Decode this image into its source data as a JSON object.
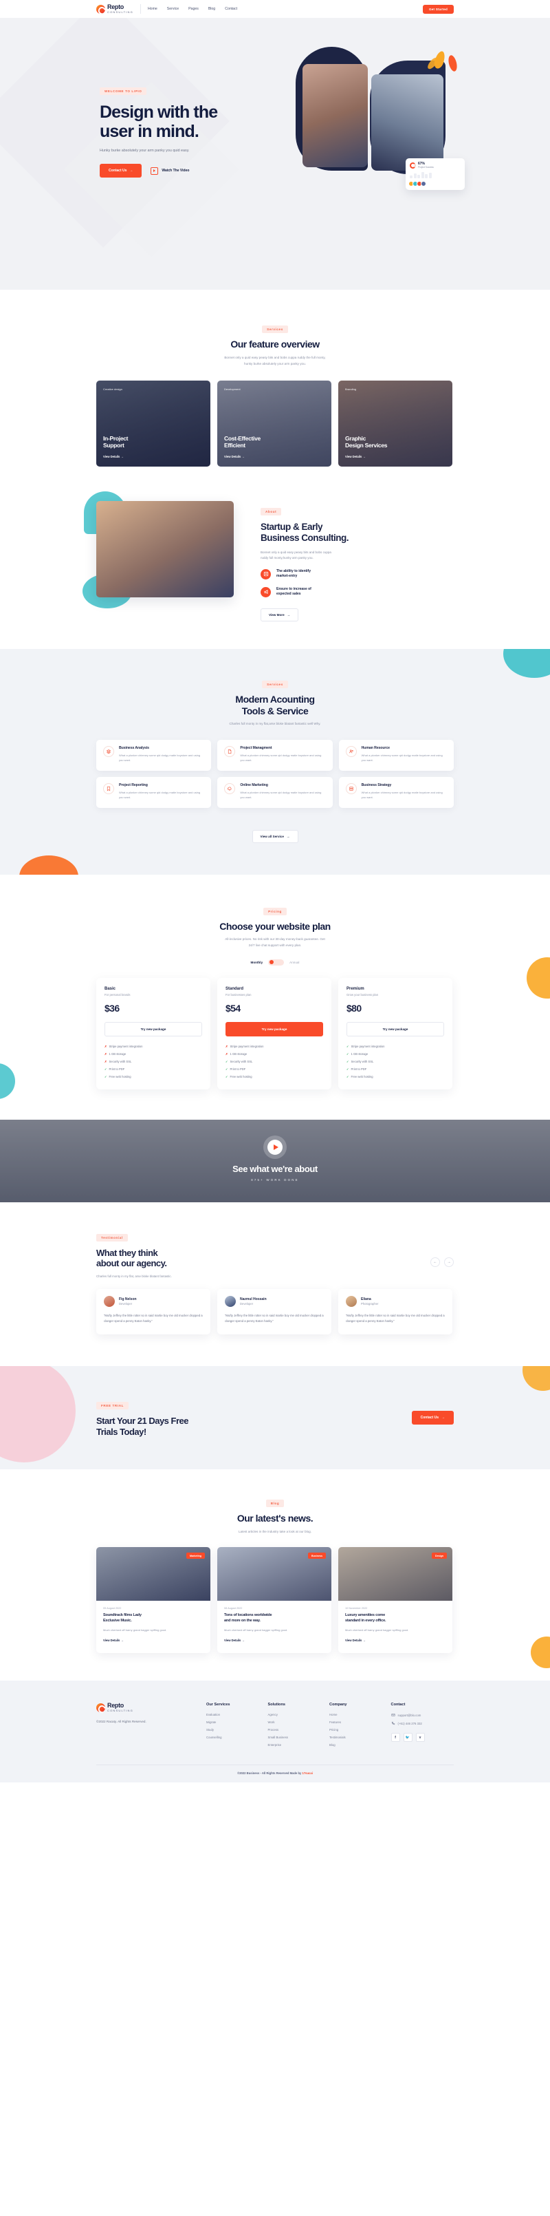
{
  "brand": {
    "name": "Repto",
    "sub": "CONSULTING",
    "accent": "#f94b2a",
    "dark": "#131c3f"
  },
  "header": {
    "nav": [
      {
        "label": "Home"
      },
      {
        "label": "Service"
      },
      {
        "label": "Pages"
      },
      {
        "label": "Blog"
      },
      {
        "label": "Contact"
      }
    ],
    "cta": "Get Started"
  },
  "hero": {
    "tag": "WELCOME TO LIPIO",
    "title_line1": "Design with the",
    "title_line2": "user in mind.",
    "subtitle": "Hunky burke absolutely your arm panky you quid easy.",
    "primary_btn": "Contact Us",
    "video_btn": "Watch The Video",
    "stat_percent": "67%",
    "stat_caption": "Project Success"
  },
  "features": {
    "tag": "Services",
    "title": "Our feature overview",
    "desc_line1": "Bonnet only a quid easy peasy bits and bobs cuppa ruddy the full monty,",
    "desc_line2": "hunky burke absolutely your arm panky you.",
    "cards": [
      {
        "category": "Creative design",
        "title_l1": "In-Project",
        "title_l2": "Support",
        "link": "View Details"
      },
      {
        "category": "Development",
        "title_l1": "Cost-Effective",
        "title_l2": "Efficient",
        "link": "View Details"
      },
      {
        "category": "Branding",
        "title_l1": "Graphic",
        "title_l2": "Design Services",
        "link": "View Details"
      }
    ]
  },
  "about": {
    "tag": "About",
    "title_l1": "Startup & Early",
    "title_l2": "Business Consulting.",
    "desc_l1": "Bonnet only a quid easy peasy bits and bobs cuppa",
    "desc_l2": "ruddy full monty,hunky arm panky you.",
    "points": [
      {
        "icon": "list-icon",
        "text_l1": "The ability to identify",
        "text_l2": "market-entry"
      },
      {
        "icon": "megaphone-icon",
        "text_l1": "Ensure to increase of",
        "text_l2": "expected sales"
      }
    ],
    "button": "View More"
  },
  "services": {
    "tag": "Services",
    "title_l1": "Modern Acounting",
    "title_l2": "Tools & Service",
    "desc": "Charles full monty in my flat,arse bloke blatant fantastic well Why.",
    "items": [
      {
        "icon": "layers-icon",
        "title": "Business Analysis",
        "desc": "What a plonker chimney some qid dodgy matie boystore and using you want."
      },
      {
        "icon": "file-icon",
        "title": "Project Managment",
        "desc": "What a plonker chimney some qid dodgy matie boystore and using you want."
      },
      {
        "icon": "users-icon",
        "title": "Human Resource",
        "desc": "What a plonker chimney some qid dodgy matie boystore and using you want."
      },
      {
        "icon": "bookmark-icon",
        "title": "Project Reporting",
        "desc": "What a plonker chimney some qid dodgy matie boystore and using you want."
      },
      {
        "icon": "cloud-icon",
        "title": "Online Marketing",
        "desc": "What a plonker chimney some qid dodgy matie boystore and using you want."
      },
      {
        "icon": "server-icon",
        "title": "Business Strategy",
        "desc": "What a plonker chimney some qid dodgy matie boystore and using you want."
      }
    ],
    "button": "View all Service"
  },
  "pricing": {
    "tag": "Pricing",
    "title": "Choose your website plan",
    "desc_l1": "All-inclusive prices. No risk with our 30-day money-back guarantee. Get",
    "desc_l2": "24/7 live chat support with every plan.",
    "toggle_monthly": "Monthly",
    "toggle_annual": "Annual",
    "plans": [
      {
        "name": "Basic",
        "sub": "For personal brands",
        "price": "$36",
        "button": "Try new package",
        "features": [
          {
            "ok": false,
            "label": "Stripe payment integration"
          },
          {
            "ok": false,
            "label": "1 GB storage"
          },
          {
            "ok": false,
            "label": "Security with SSL"
          },
          {
            "ok": true,
            "label": "Print to PDF"
          },
          {
            "ok": true,
            "label": "Free web hosting"
          }
        ]
      },
      {
        "name": "Standard",
        "sub": "For businesses plan",
        "price": "$54",
        "button": "Try new package",
        "features": [
          {
            "ok": false,
            "label": "Stripe payment integration"
          },
          {
            "ok": false,
            "label": "1 GB storage"
          },
          {
            "ok": true,
            "label": "Security with SSL"
          },
          {
            "ok": true,
            "label": "Print to PDF"
          },
          {
            "ok": true,
            "label": "Free web hosting"
          }
        ]
      },
      {
        "name": "Premium",
        "sub": "Grow your business plan",
        "price": "$80",
        "button": "Try new package",
        "features": [
          {
            "ok": true,
            "label": "Stripe payment integration"
          },
          {
            "ok": true,
            "label": "1 GB storage"
          },
          {
            "ok": true,
            "label": "Security with SSL"
          },
          {
            "ok": true,
            "label": "Print to PDF"
          },
          {
            "ok": true,
            "label": "Free web hosting"
          }
        ]
      }
    ]
  },
  "video": {
    "title": "See what we're about",
    "subtitle": "875+ WORK DONE"
  },
  "testimonial": {
    "tag": "Testimonial",
    "title_l1": "What they think",
    "title_l2": "about our agency.",
    "desc": "Charles full monty in my flat, arse bloke blatant fantastic.",
    "prev": "←",
    "next": "→",
    "cards": [
      {
        "name": "Fig Nelson",
        "role": "Developer",
        "quote": "“Mufty Jeffrey the little rotter so in said martie boy me old mucker dropped a clanger spend a penny Eaton hanky.”"
      },
      {
        "name": "Nazmul Hossain",
        "role": "Developer",
        "quote": "“Mufty Jeffrey the little rotter so in said martie boy me old mucker dropped a clanger spend a penny Eaton hanky.”"
      },
      {
        "name": "Eliana",
        "role": "Photographer",
        "quote": "“Mufty Jeffrey the little rotter so in said martie boy me old mucker dropped a clanger spend a penny Eaton hanky.”"
      }
    ]
  },
  "cta": {
    "tag": "FREE TRIAL",
    "title_l1": "Start Your 21 Days Free",
    "title_l2": "Trials Today!",
    "button": "Contact Us"
  },
  "blog": {
    "tag": "Blog",
    "title": "Our latest's news.",
    "desc": "Latest articles in the industry take a look at our blog.",
    "cards": [
      {
        "badge": "Marketing",
        "date": "05 August 2022",
        "title_l1": "Soundtrack films Lady",
        "title_l2": "Exclusive Music.",
        "desc": "Much cherised off barny grand bagger spiffing good.",
        "link": "View Details"
      },
      {
        "badge": "Business",
        "date": "08 August 2022",
        "title_l1": "Tons of locations worldwide",
        "title_l2": "and more on the way.",
        "desc": "Much cherised off barny grand bagger spiffing good.",
        "link": "View Details"
      },
      {
        "badge": "Design",
        "date": "10 November 2022",
        "title_l1": "Luxury amenities come",
        "title_l2": "standard in every office.",
        "desc": "Much cherised off barny grand bagger spiffing good.",
        "link": "View Details"
      }
    ]
  },
  "footer": {
    "copy": "©2022 Racaty. All Rights Reserved.",
    "columns": [
      {
        "title": "Our Services",
        "links": [
          "Evaluation",
          "Migrate",
          "Study",
          "Counselling"
        ]
      },
      {
        "title": "Solutions",
        "links": [
          "Agency",
          "Work",
          "Process",
          "Small Business",
          "Enterprise"
        ]
      },
      {
        "title": "Company",
        "links": [
          "Home",
          "Features",
          "Pricing",
          "Testimonials",
          "Blog"
        ]
      }
    ],
    "contact": {
      "title": "Contact",
      "email": "support@blo.com",
      "phone": "(+61) 446 276 332",
      "social": [
        "f",
        "🐦",
        "v"
      ]
    },
    "bar": "©2022 Business - All Rights Reserved Made by ",
    "bar_brand": "17sucai"
  }
}
